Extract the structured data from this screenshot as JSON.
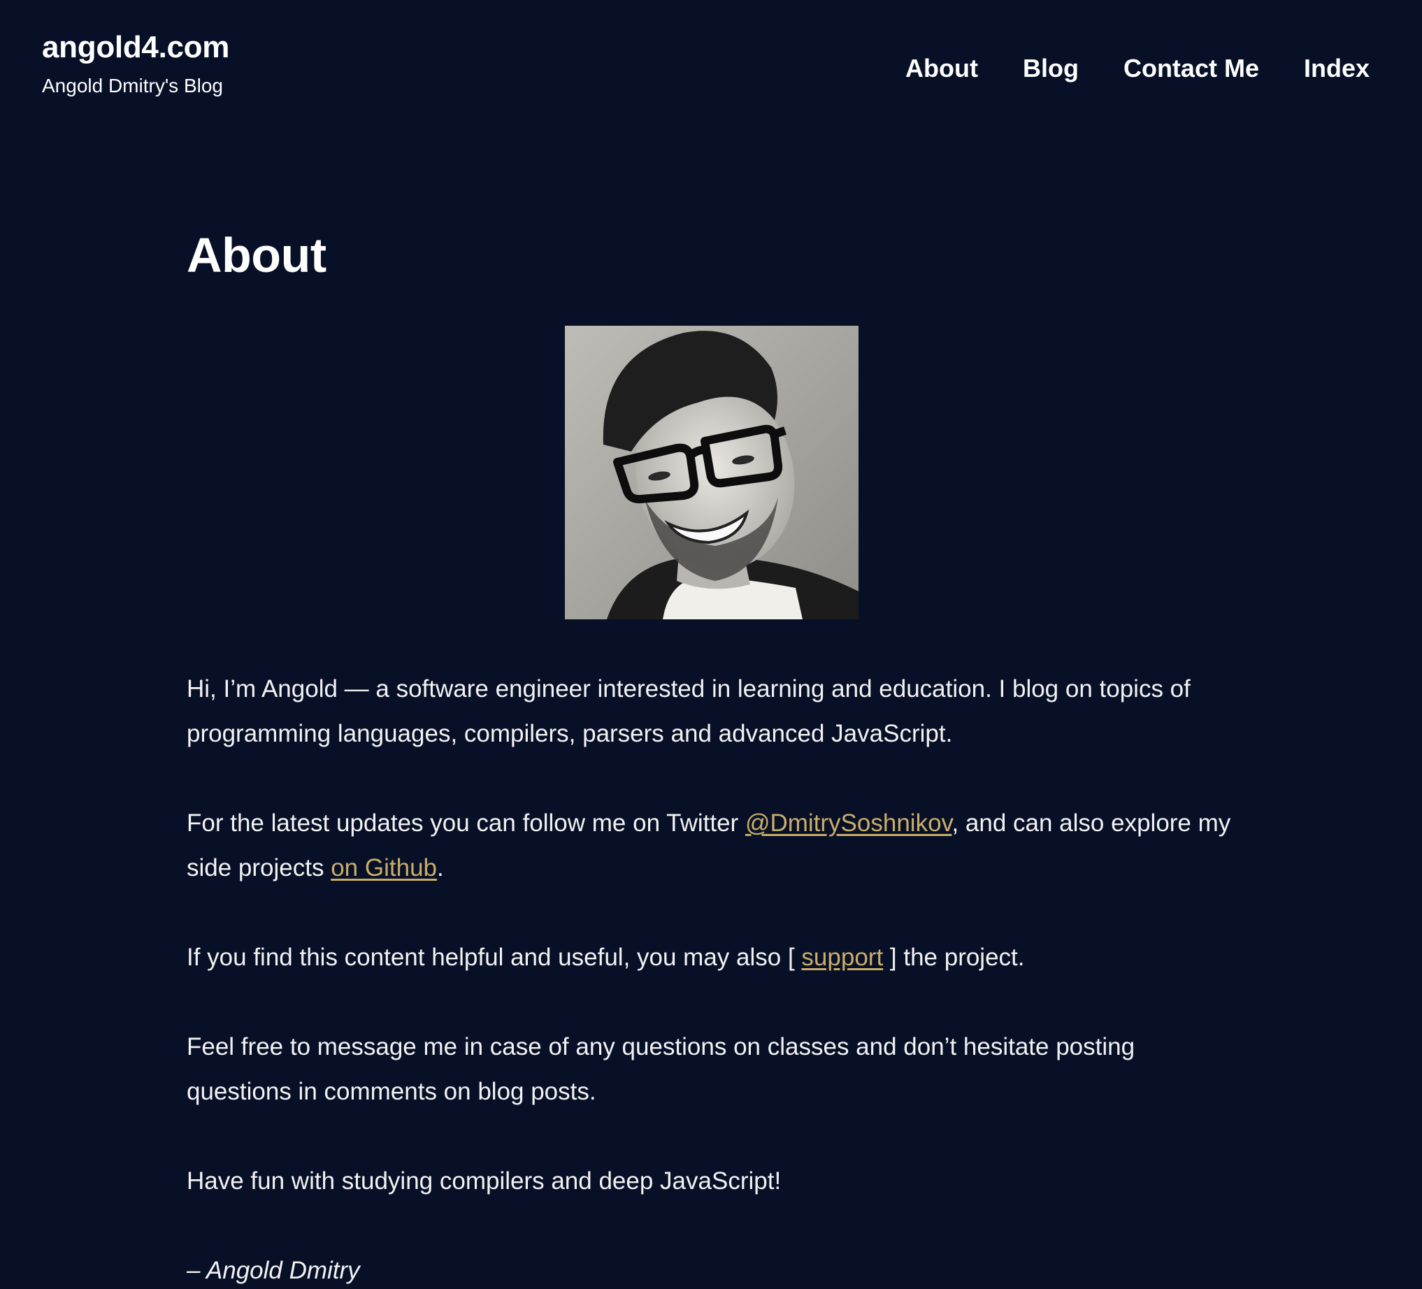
{
  "header": {
    "site_title": "angold4.com",
    "site_subtitle": "Angold Dmitry's Blog",
    "nav": [
      {
        "label": "About"
      },
      {
        "label": "Blog"
      },
      {
        "label": "Contact Me"
      },
      {
        "label": "Index"
      }
    ]
  },
  "main": {
    "title": "About",
    "avatar_icon": "portrait-photo",
    "paragraphs": {
      "p1": "Hi, I’m Angold — a software engineer interested in learning and education. I blog on topics of programming languages, compilers, parsers and advanced JavaScript.",
      "p2_before": "For the latest updates you can follow me on Twitter ",
      "p2_link1": "@DmitrySoshnikov",
      "p2_middle": ", and can also explore my side projects ",
      "p2_link2": "on Github",
      "p2_after": ".",
      "p3_before": "If you find this content helpful and useful, you may also [ ",
      "p3_link": "support",
      "p3_after": " ] the project.",
      "p4": "Feel free to message me in case of any questions on classes and don’t hesitate posting questions in comments on blog posts.",
      "p5": "Have fun with studying compilers and deep JavaScript!",
      "signature": "– Angold Dmitry"
    }
  },
  "colors": {
    "background": "#081027",
    "text": "#f2f2f2",
    "link": "#c9ad6a"
  }
}
